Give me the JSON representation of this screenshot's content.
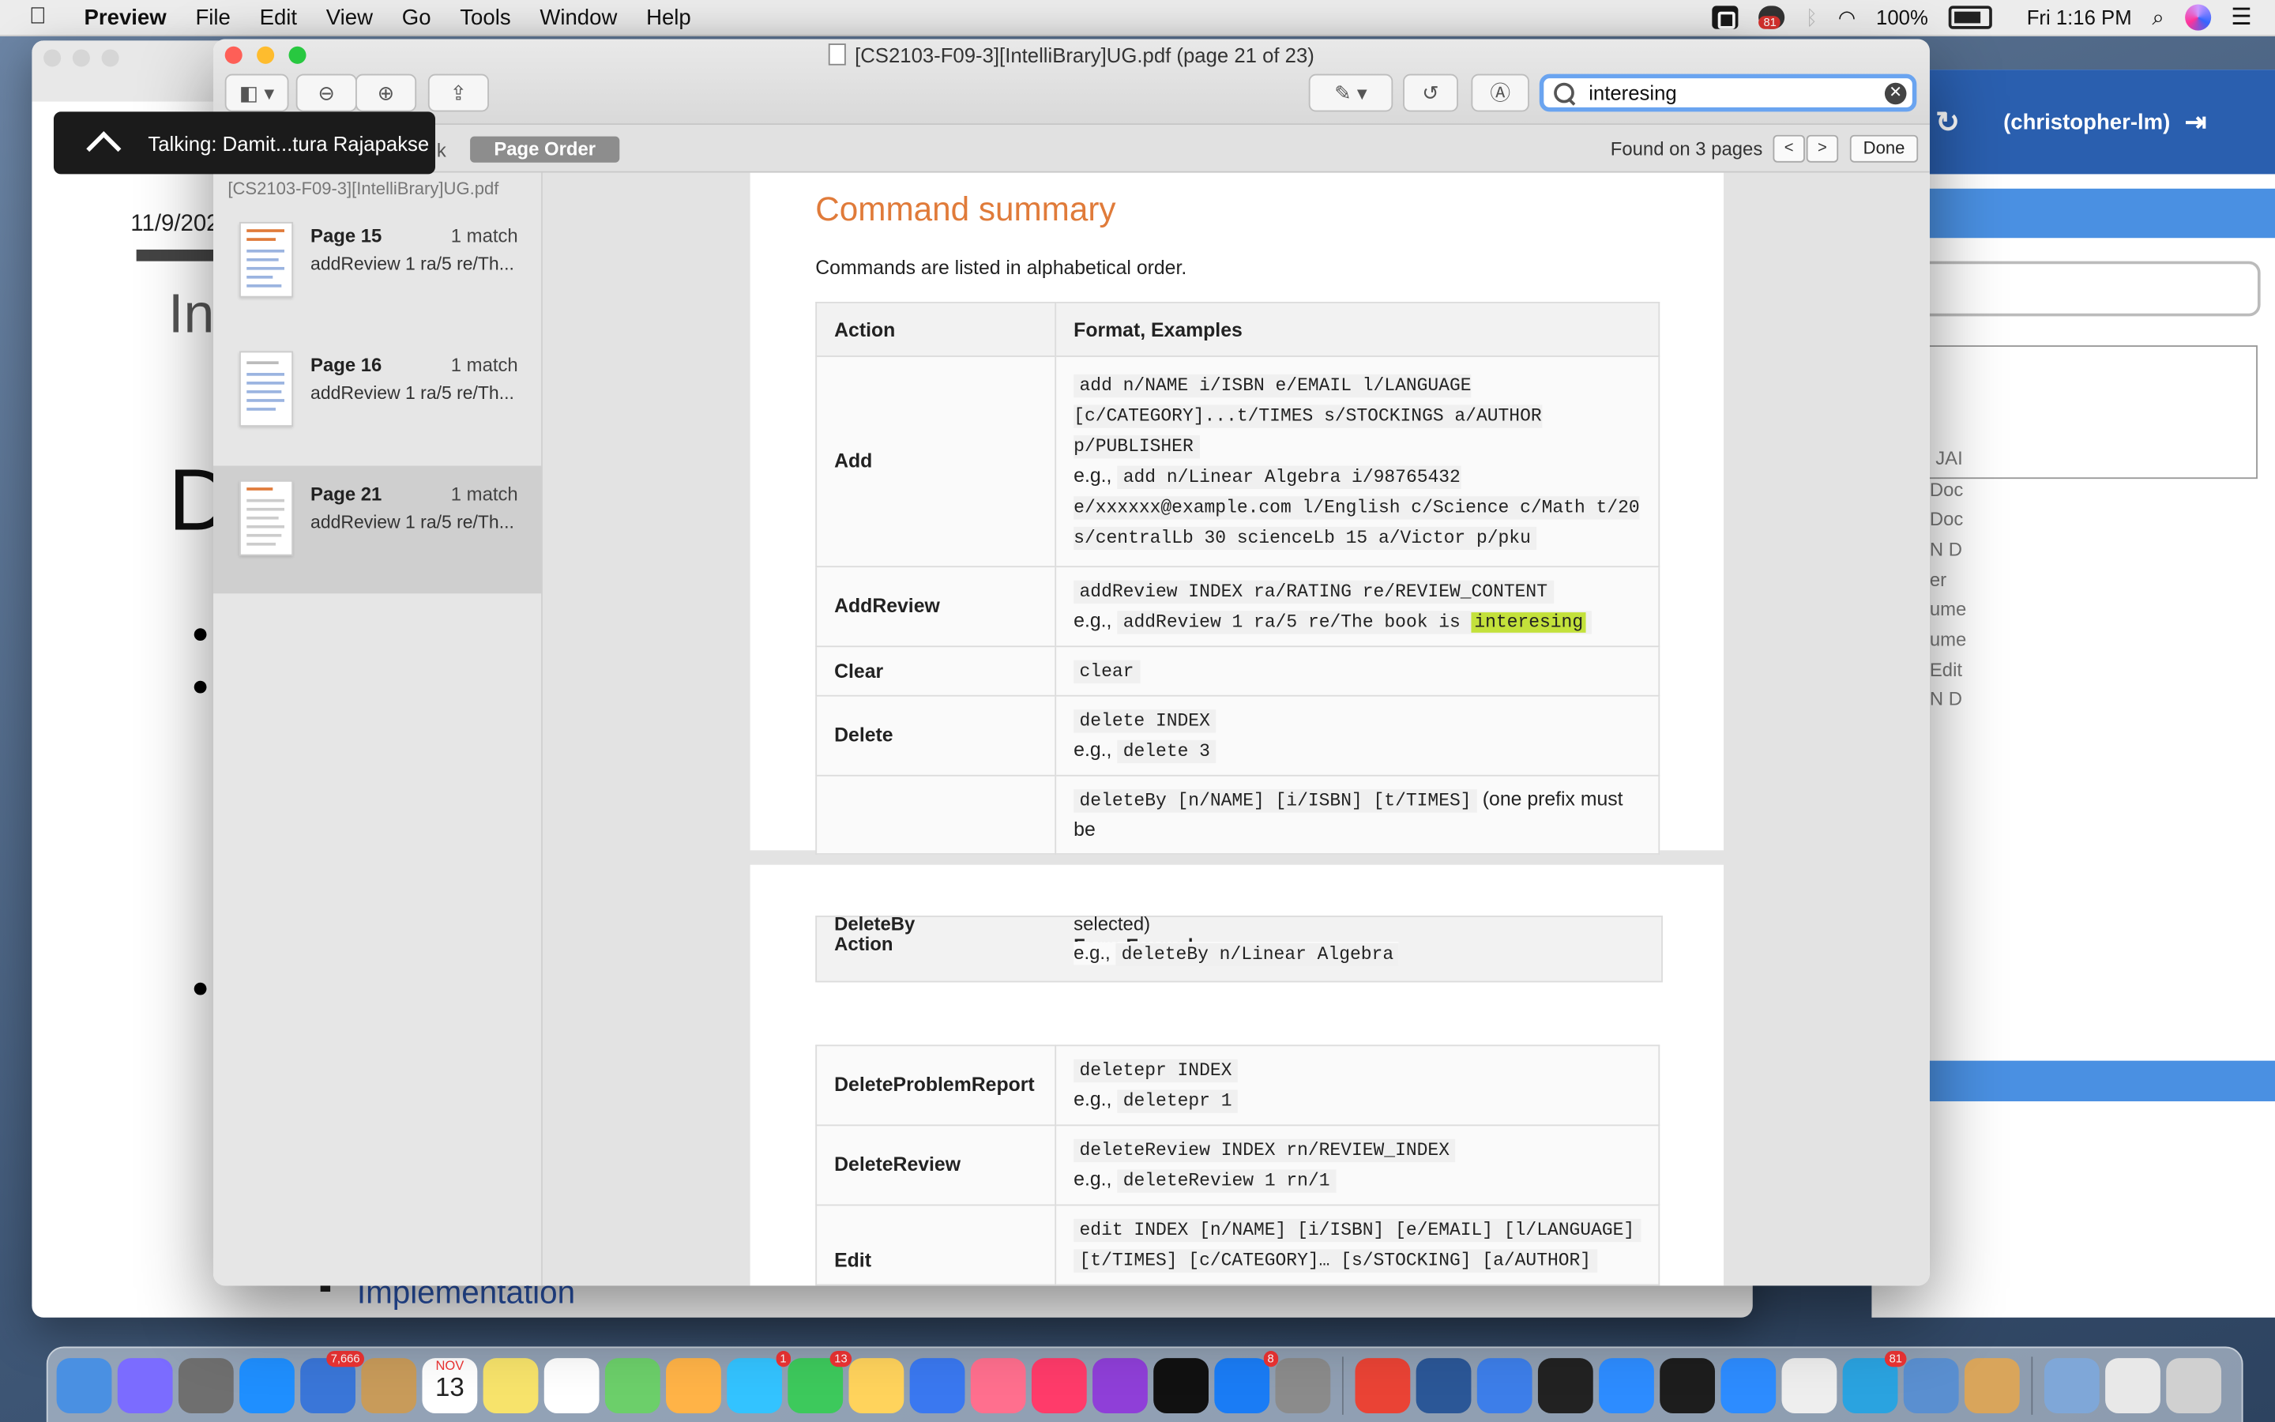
{
  "menubar": {
    "app_name": "Preview",
    "items": [
      "File",
      "Edit",
      "View",
      "Go",
      "Tools",
      "Window",
      "Help"
    ],
    "zoom_badge": "81",
    "battery": "100%",
    "clock": "Fri 1:16 PM"
  },
  "talking": {
    "label": "Talking: Damit...tura Rajapakse"
  },
  "background": {
    "slides_date": "11/9/202",
    "slides_title_frag": "Int",
    "slides_letter_frag": "D",
    "slides_implementation": "Implementation",
    "webapp_user": "(christopher-lm)",
    "webapp_frags": [
      "JAI",
      "Doc",
      "Doc",
      "N D",
      "er",
      "ume",
      "ume",
      "Edit",
      "N D"
    ]
  },
  "preview": {
    "title": "[CS2103-F09-3][IntelliBrary]UG.pdf (page 21 of 23)",
    "search_value": "interesing",
    "segment_frag": "k",
    "segment_active": "Page Order",
    "found_text": "Found on 3 pages",
    "prev": "<",
    "next": ">",
    "done": "Done",
    "sidebar_filename": "[CS2103-F09-3][IntelliBrary]UG.pdf",
    "results": [
      {
        "page": "Page 15",
        "count": "1 match",
        "snippet": "addReview 1 ra/5 re/Th..."
      },
      {
        "page": "Page 16",
        "count": "1 match",
        "snippet": "addReview 1 ra/5 re/Th..."
      },
      {
        "page": "Page 21",
        "count": "1 match",
        "snippet": "addReview 1 ra/5 re/Th..."
      }
    ]
  },
  "doc": {
    "heading": "Command summary",
    "intro": "Commands are listed in alphabetical order.",
    "col_action": "Action",
    "col_format": "Format, Examples",
    "eg": "e.g.,",
    "add": {
      "action": "Add",
      "format": "add n/NAME i/ISBN e/EMAIL l/LANGUAGE [c/CATEGORY]...t/TIMES s/STOCKINGS a/AUTHOR p/PUBLISHER",
      "example": "add n/Linear Algebra i/98765432 e/xxxxxx@example.com l/English c/Science c/Math t/20 s/centralLb 30 scienceLb 15 a/Victor p/pku"
    },
    "addreview": {
      "action": "AddReview",
      "format": "addReview INDEX ra/RATING re/REVIEW_CONTENT",
      "example_pre": "addReview 1 ra/5 re/The book is",
      "highlight": "interesing"
    },
    "clear": {
      "action": "Clear",
      "format": "clear"
    },
    "delete": {
      "action": "Delete",
      "format": "delete INDEX",
      "example": "delete 3"
    },
    "deleteby": {
      "action": "DeleteBy",
      "format": "deleteBy [n/NAME] [i/ISBN] [t/TIMES]",
      "note": "(one prefix must be",
      "note2": "selected)",
      "example": "deleteBy n/Linear Algebra"
    },
    "page2_header_action": "Action",
    "page2_header_format": "Form    Exampl",
    "deleteproblemreport": {
      "action": "DeleteProblemReport",
      "format": "deletepr INDEX",
      "example": "deletepr 1"
    },
    "deletereview": {
      "action": "DeleteReview",
      "format": "deleteReview INDEX rn/REVIEW_INDEX",
      "example": "deleteReview 1 rn/1"
    },
    "edit": {
      "action": "Edit",
      "format1": "edit INDEX [n/NAME] [i/ISBN] [e/EMAIL] [l/LANGUAGE]",
      "format2": "[t/TIMES] [c/CATEGORY]… [s/STOCKING] [a/AUTHOR]"
    }
  },
  "dock": {
    "badges": {
      "mail": "7,666",
      "calendar_month": "NOV",
      "calendar_day": "13",
      "messages": "1",
      "facetime": "13",
      "appstore": "8",
      "telegram": "81"
    },
    "colors": [
      "#4a90e2",
      "#7b6cff",
      "#6f6f6f",
      "#1f8fff",
      "#3a76d8",
      "#c89b5a",
      "#ffffff",
      "#f7e36b",
      "#ffffff",
      "#6ccf6a",
      "#ffb347",
      "#33c3ff",
      "#3dc95c",
      "#ffd35c",
      "#3a78f0",
      "#ff6f8e",
      "#ff3b6a",
      "#8f3fd8",
      "#111111",
      "#1a7cf5",
      "#8b8b8b",
      "#ea4335",
      "#2b5797",
      "#3d7ee9",
      "#222222",
      "#2d8cff",
      "#1d1d1d",
      "#2d8cff",
      "#eeeeee",
      "#2aa3e0",
      "#5a8fd0",
      "#d9a55b",
      "#7fa7d8",
      "#e8e8e8",
      "#d0d0d0"
    ]
  }
}
